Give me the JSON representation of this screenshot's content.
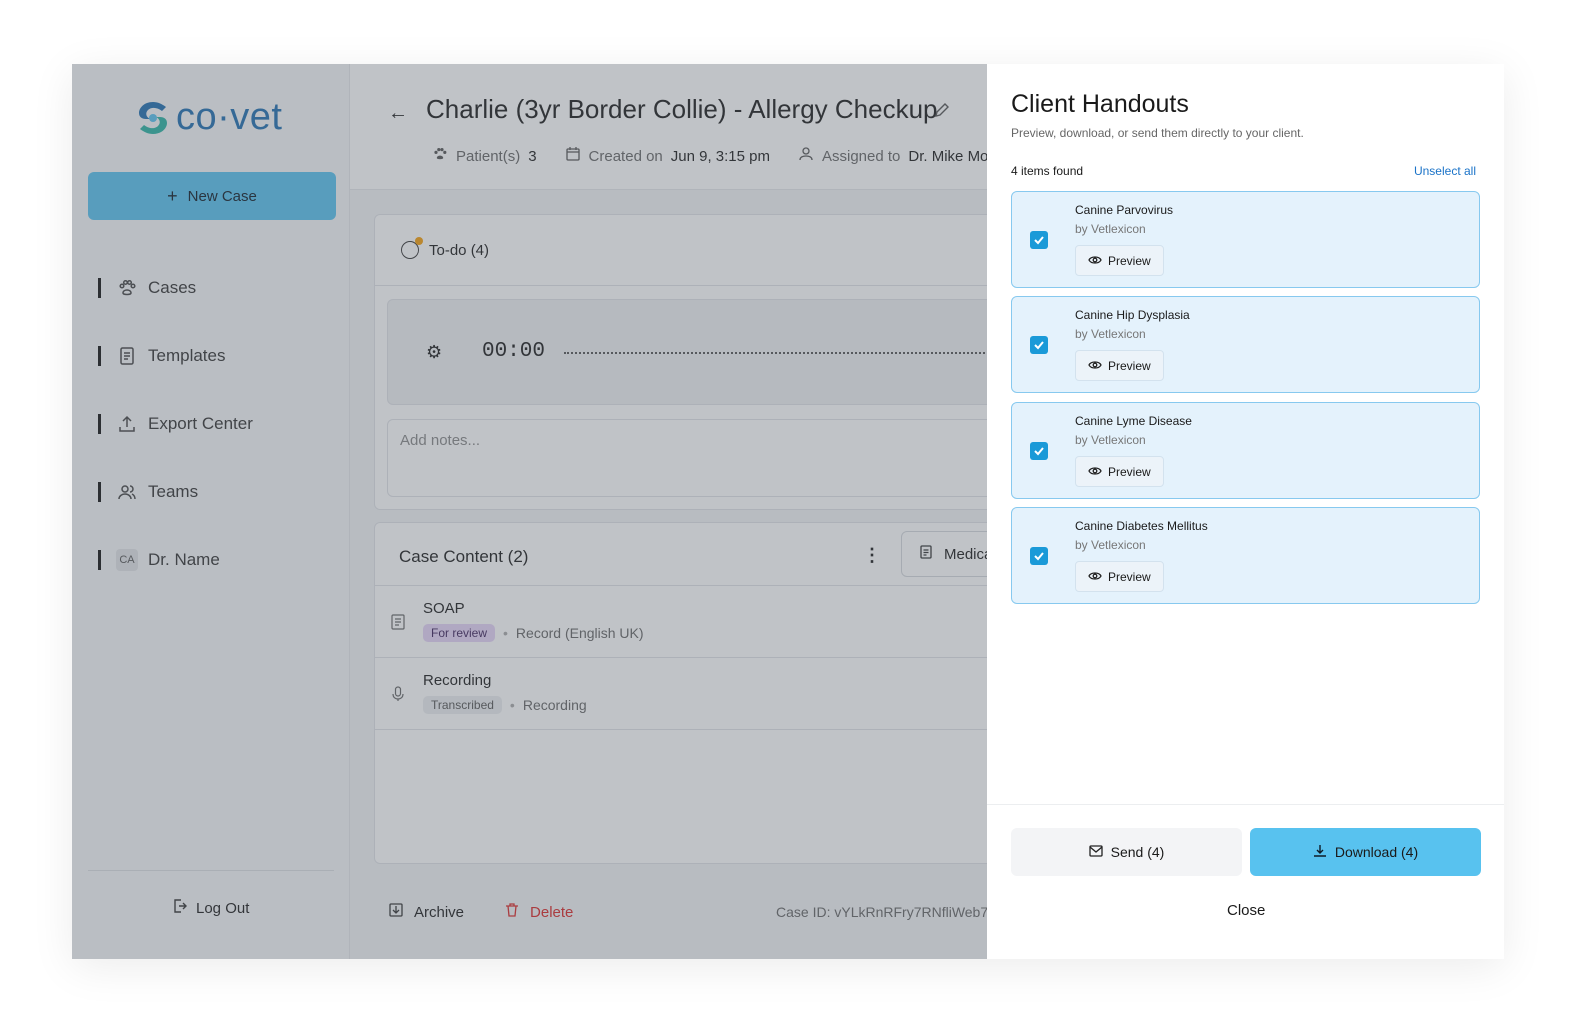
{
  "app": {
    "logo_text": "co·vet",
    "brand_color": "#1f6fb0",
    "accent": "#58c2ef"
  },
  "sidebar": {
    "new_case": "New Case",
    "items": [
      {
        "label": "Cases",
        "icon": "paw-icon"
      },
      {
        "label": "Templates",
        "icon": "document-icon"
      },
      {
        "label": "Export Center",
        "icon": "upload-icon"
      },
      {
        "label": "Teams",
        "icon": "users-icon"
      },
      {
        "label": "Dr. Name",
        "icon": "avatar-initials",
        "initials": "CA"
      }
    ],
    "logout": "Log Out"
  },
  "case": {
    "title": "Charlie (3yr Border Collie) - Allergy Checkup",
    "patients_label": "Patient(s)",
    "patients_value": "3",
    "created_label": "Created on",
    "created_value": "Jun 9, 3:15 pm",
    "assigned_label": "Assigned to",
    "assigned_value": "Dr. Mike Mo"
  },
  "todo": {
    "label": "To-do (4)",
    "timer": "00:00",
    "notes_placeholder": "Add notes..."
  },
  "content": {
    "title": "Case Content (2)",
    "medical_btn": "Medica",
    "rows": [
      {
        "name": "SOAP",
        "badge": "For review",
        "sub": "Record (English UK)"
      },
      {
        "name": "Recording",
        "badge": "Transcribed",
        "sub": "Recording"
      }
    ]
  },
  "footer": {
    "archive": "Archive",
    "delete": "Delete",
    "case_id": "Case ID: vYLkRnRFry7RNfliWeb7"
  },
  "drawer": {
    "title": "Client Handouts",
    "subtitle": "Preview, download, or send them directly to your client.",
    "count": "4 items found",
    "unselect": "Unselect all",
    "items": [
      {
        "name": "Canine Parvovirus",
        "by": "by Vetlexicon",
        "preview": "Preview",
        "checked": true
      },
      {
        "name": "Canine Hip Dysplasia",
        "by": "by Vetlexicon",
        "preview": "Preview",
        "checked": true
      },
      {
        "name": "Canine Lyme Disease",
        "by": "by Vetlexicon",
        "preview": "Preview",
        "checked": true
      },
      {
        "name": "Canine Diabetes Mellitus",
        "by": "by Vetlexicon",
        "preview": "Preview",
        "checked": true
      }
    ],
    "send": "Send (4)",
    "download": "Download (4)",
    "close": "Close"
  }
}
